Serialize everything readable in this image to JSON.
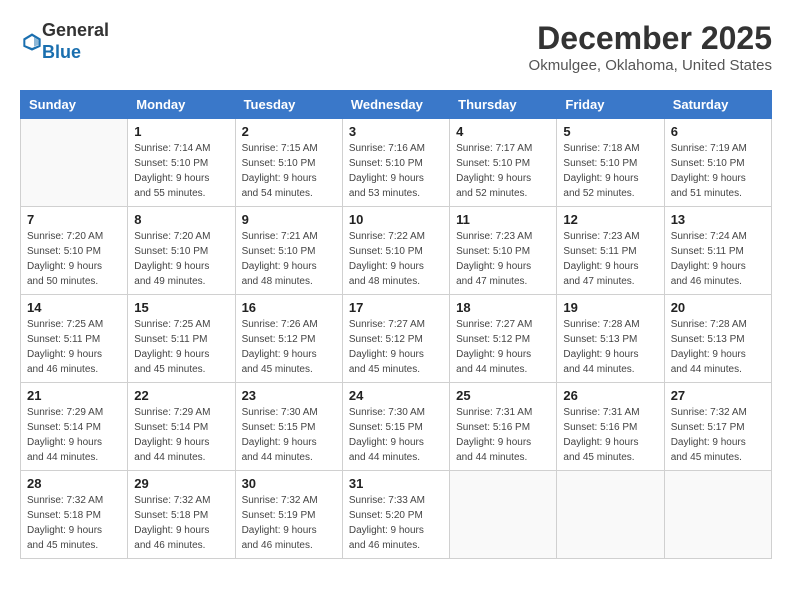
{
  "logo": {
    "general": "General",
    "blue": "Blue"
  },
  "title": "December 2025",
  "subtitle": "Okmulgee, Oklahoma, United States",
  "calendar": {
    "headers": [
      "Sunday",
      "Monday",
      "Tuesday",
      "Wednesday",
      "Thursday",
      "Friday",
      "Saturday"
    ],
    "weeks": [
      [
        {
          "day": "",
          "info": ""
        },
        {
          "day": "1",
          "info": "Sunrise: 7:14 AM\nSunset: 5:10 PM\nDaylight: 9 hours\nand 55 minutes."
        },
        {
          "day": "2",
          "info": "Sunrise: 7:15 AM\nSunset: 5:10 PM\nDaylight: 9 hours\nand 54 minutes."
        },
        {
          "day": "3",
          "info": "Sunrise: 7:16 AM\nSunset: 5:10 PM\nDaylight: 9 hours\nand 53 minutes."
        },
        {
          "day": "4",
          "info": "Sunrise: 7:17 AM\nSunset: 5:10 PM\nDaylight: 9 hours\nand 52 minutes."
        },
        {
          "day": "5",
          "info": "Sunrise: 7:18 AM\nSunset: 5:10 PM\nDaylight: 9 hours\nand 52 minutes."
        },
        {
          "day": "6",
          "info": "Sunrise: 7:19 AM\nSunset: 5:10 PM\nDaylight: 9 hours\nand 51 minutes."
        }
      ],
      [
        {
          "day": "7",
          "info": "Sunrise: 7:20 AM\nSunset: 5:10 PM\nDaylight: 9 hours\nand 50 minutes."
        },
        {
          "day": "8",
          "info": "Sunrise: 7:20 AM\nSunset: 5:10 PM\nDaylight: 9 hours\nand 49 minutes."
        },
        {
          "day": "9",
          "info": "Sunrise: 7:21 AM\nSunset: 5:10 PM\nDaylight: 9 hours\nand 48 minutes."
        },
        {
          "day": "10",
          "info": "Sunrise: 7:22 AM\nSunset: 5:10 PM\nDaylight: 9 hours\nand 48 minutes."
        },
        {
          "day": "11",
          "info": "Sunrise: 7:23 AM\nSunset: 5:10 PM\nDaylight: 9 hours\nand 47 minutes."
        },
        {
          "day": "12",
          "info": "Sunrise: 7:23 AM\nSunset: 5:11 PM\nDaylight: 9 hours\nand 47 minutes."
        },
        {
          "day": "13",
          "info": "Sunrise: 7:24 AM\nSunset: 5:11 PM\nDaylight: 9 hours\nand 46 minutes."
        }
      ],
      [
        {
          "day": "14",
          "info": "Sunrise: 7:25 AM\nSunset: 5:11 PM\nDaylight: 9 hours\nand 46 minutes."
        },
        {
          "day": "15",
          "info": "Sunrise: 7:25 AM\nSunset: 5:11 PM\nDaylight: 9 hours\nand 45 minutes."
        },
        {
          "day": "16",
          "info": "Sunrise: 7:26 AM\nSunset: 5:12 PM\nDaylight: 9 hours\nand 45 minutes."
        },
        {
          "day": "17",
          "info": "Sunrise: 7:27 AM\nSunset: 5:12 PM\nDaylight: 9 hours\nand 45 minutes."
        },
        {
          "day": "18",
          "info": "Sunrise: 7:27 AM\nSunset: 5:12 PM\nDaylight: 9 hours\nand 44 minutes."
        },
        {
          "day": "19",
          "info": "Sunrise: 7:28 AM\nSunset: 5:13 PM\nDaylight: 9 hours\nand 44 minutes."
        },
        {
          "day": "20",
          "info": "Sunrise: 7:28 AM\nSunset: 5:13 PM\nDaylight: 9 hours\nand 44 minutes."
        }
      ],
      [
        {
          "day": "21",
          "info": "Sunrise: 7:29 AM\nSunset: 5:14 PM\nDaylight: 9 hours\nand 44 minutes."
        },
        {
          "day": "22",
          "info": "Sunrise: 7:29 AM\nSunset: 5:14 PM\nDaylight: 9 hours\nand 44 minutes."
        },
        {
          "day": "23",
          "info": "Sunrise: 7:30 AM\nSunset: 5:15 PM\nDaylight: 9 hours\nand 44 minutes."
        },
        {
          "day": "24",
          "info": "Sunrise: 7:30 AM\nSunset: 5:15 PM\nDaylight: 9 hours\nand 44 minutes."
        },
        {
          "day": "25",
          "info": "Sunrise: 7:31 AM\nSunset: 5:16 PM\nDaylight: 9 hours\nand 44 minutes."
        },
        {
          "day": "26",
          "info": "Sunrise: 7:31 AM\nSunset: 5:16 PM\nDaylight: 9 hours\nand 45 minutes."
        },
        {
          "day": "27",
          "info": "Sunrise: 7:32 AM\nSunset: 5:17 PM\nDaylight: 9 hours\nand 45 minutes."
        }
      ],
      [
        {
          "day": "28",
          "info": "Sunrise: 7:32 AM\nSunset: 5:18 PM\nDaylight: 9 hours\nand 45 minutes."
        },
        {
          "day": "29",
          "info": "Sunrise: 7:32 AM\nSunset: 5:18 PM\nDaylight: 9 hours\nand 46 minutes."
        },
        {
          "day": "30",
          "info": "Sunrise: 7:32 AM\nSunset: 5:19 PM\nDaylight: 9 hours\nand 46 minutes."
        },
        {
          "day": "31",
          "info": "Sunrise: 7:33 AM\nSunset: 5:20 PM\nDaylight: 9 hours\nand 46 minutes."
        },
        {
          "day": "",
          "info": ""
        },
        {
          "day": "",
          "info": ""
        },
        {
          "day": "",
          "info": ""
        }
      ]
    ]
  }
}
